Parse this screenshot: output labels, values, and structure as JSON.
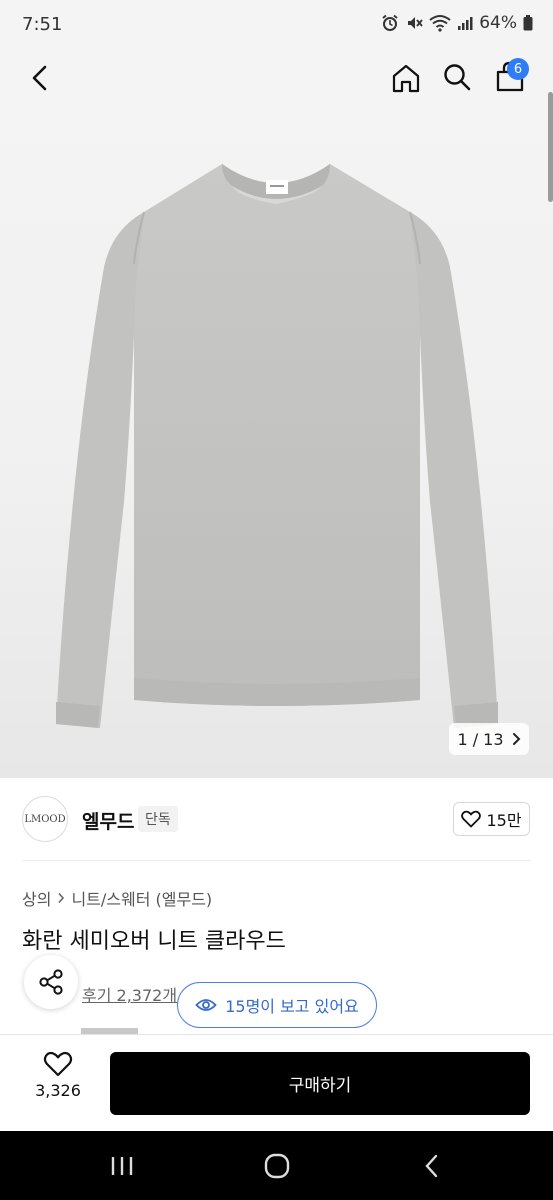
{
  "status_bar": {
    "time": "7:51",
    "battery": "64%"
  },
  "header": {
    "cart_count": "6"
  },
  "gallery": {
    "counter": "1 / 13"
  },
  "brand": {
    "logo_text": "LMOOD",
    "name": "엘무드",
    "tag": "단독",
    "likes": "15만"
  },
  "breadcrumb": {
    "category": "상의",
    "subcategory": "니트/스웨터 (엘무드)"
  },
  "product": {
    "title": "화란 세미오버 니트 클라우드",
    "reviews": "후기 2,372개",
    "viewers": "15명이 보고 있어요"
  },
  "bottom_bar": {
    "wish_count": "3,326",
    "buy_label": "구매하기"
  },
  "colors": {
    "accent": "#2f7df6",
    "viewers_text": "#3569cc",
    "buy_bg": "#000000",
    "sweater": "#c4c4c2"
  }
}
